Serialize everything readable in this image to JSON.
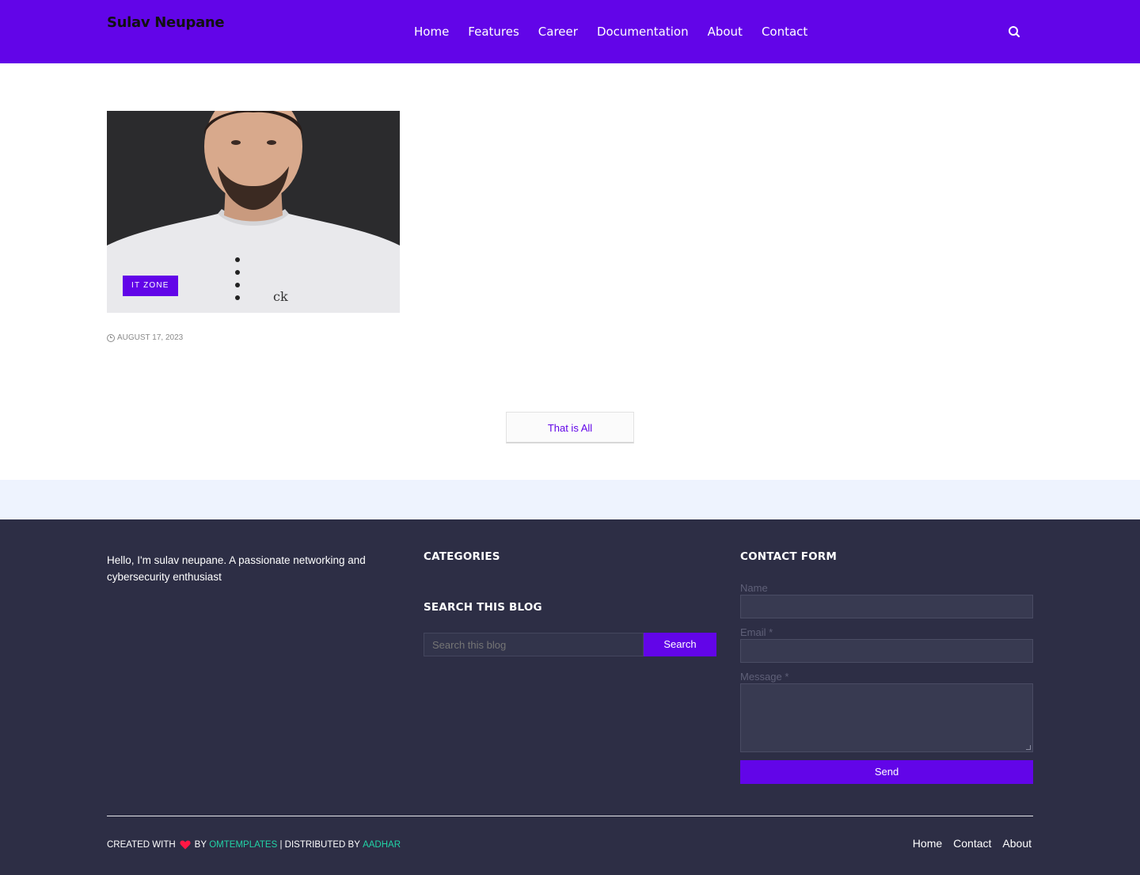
{
  "header": {
    "brand": "Sulav Neupane",
    "nav": [
      "Home",
      "Features",
      "Career",
      "Documentation",
      "About",
      "Contact"
    ],
    "search_icon": "search-icon"
  },
  "post": {
    "category": "IT ZONE",
    "date": "AUGUST 17, 2023",
    "image": "portrait-photo",
    "clock_icon": "clock-icon"
  },
  "pager": {
    "label": "That is All"
  },
  "footer": {
    "about": "Hello, I'm sulav neupane. A passionate networking and cybersecurity enthusiast",
    "categories_heading": "CATEGORIES",
    "search_heading": "SEARCH THIS BLOG",
    "search_placeholder": "Search this blog",
    "search_button": "Search",
    "contact_heading": "CONTACT FORM",
    "name_label": "Name",
    "email_label": "Email *",
    "message_label": "Message *",
    "send_button": "Send",
    "credits": {
      "created_with": "CREATED WITH",
      "by": "BY",
      "author": "OMTEMPLATES",
      "distributed_by": "| DISTRIBUTED BY",
      "distributor": "AADHAR"
    },
    "menu": [
      "Home",
      "Contact",
      "About"
    ]
  },
  "colors": {
    "accent": "#6205e8",
    "footer_bg": "#2d2e45",
    "link": "#22d3a6",
    "heart": "#ff1744"
  }
}
